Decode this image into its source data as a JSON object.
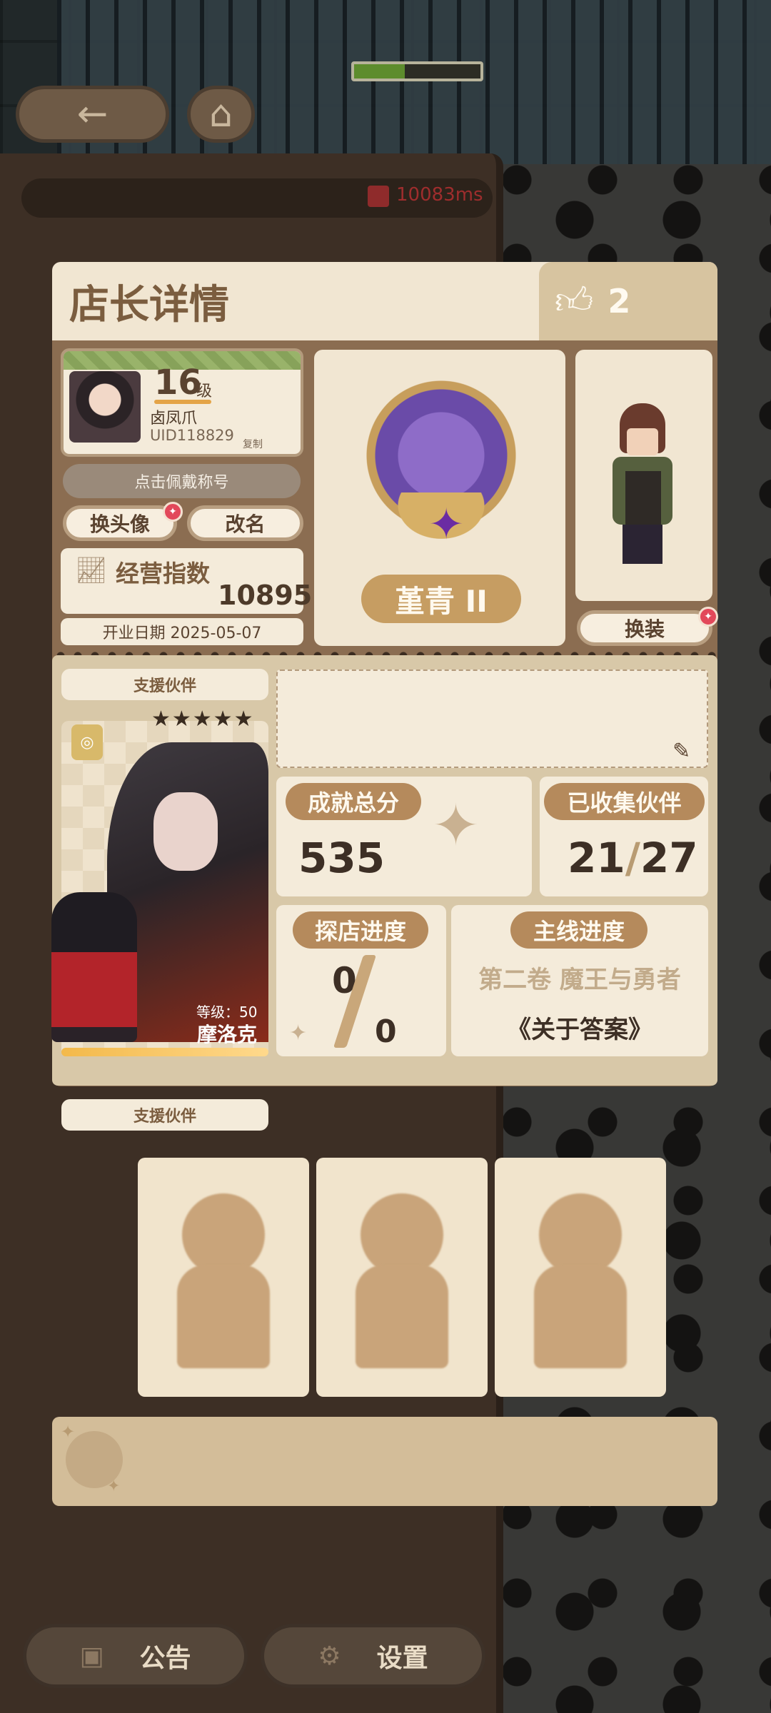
{
  "top": {
    "back_icon": "arrow-left-icon",
    "home_icon": "home-icon",
    "ping": "10083ms",
    "ping_icon": "signal-bars-icon"
  },
  "popup": {
    "title": "店长详情",
    "likes": "2",
    "like_icon": "thumbs-up-icon",
    "profile": {
      "level": "16",
      "level_unit": "级",
      "nickname": "卤凤爪",
      "uid": "UID118829",
      "copy_label": "复制"
    },
    "title_button": "点击佩戴称号",
    "change_avatar": "换头像",
    "rename": "改名",
    "business_index_label": "经营指数",
    "business_index_value": "10895",
    "open_date": "开业日期 2025-05-07",
    "rank_name": "堇青 II",
    "outfit_button": "换装",
    "support_label": "支援伙伴",
    "partner": {
      "stars": "★★★★★",
      "star_count": 5,
      "level_text": "等级：50",
      "name": "摩洛克"
    },
    "achievement_label": "成就总分",
    "achievement_value": "535",
    "collected_label": "已收集伙伴",
    "collected_current": "21",
    "collected_total": "27",
    "visit_label": "探店进度",
    "visit_current": "0",
    "visit_total": "0",
    "story_label": "主线进度",
    "story_volume": "第二卷 魔王与勇者",
    "story_chapter": "《关于答案》",
    "support_label_2": "支援伙伴"
  },
  "bottom": {
    "notice": "公告",
    "settings": "设置",
    "notice_icon": "briefcase-icon",
    "settings_icon": "gear-icon"
  },
  "colors": {
    "panel_bg": "#8b6d51",
    "card_bg": "#f4ebda",
    "accent_brown": "#b58a5c",
    "rank_gold": "#c69d62",
    "red_dot": "#e2485a"
  }
}
